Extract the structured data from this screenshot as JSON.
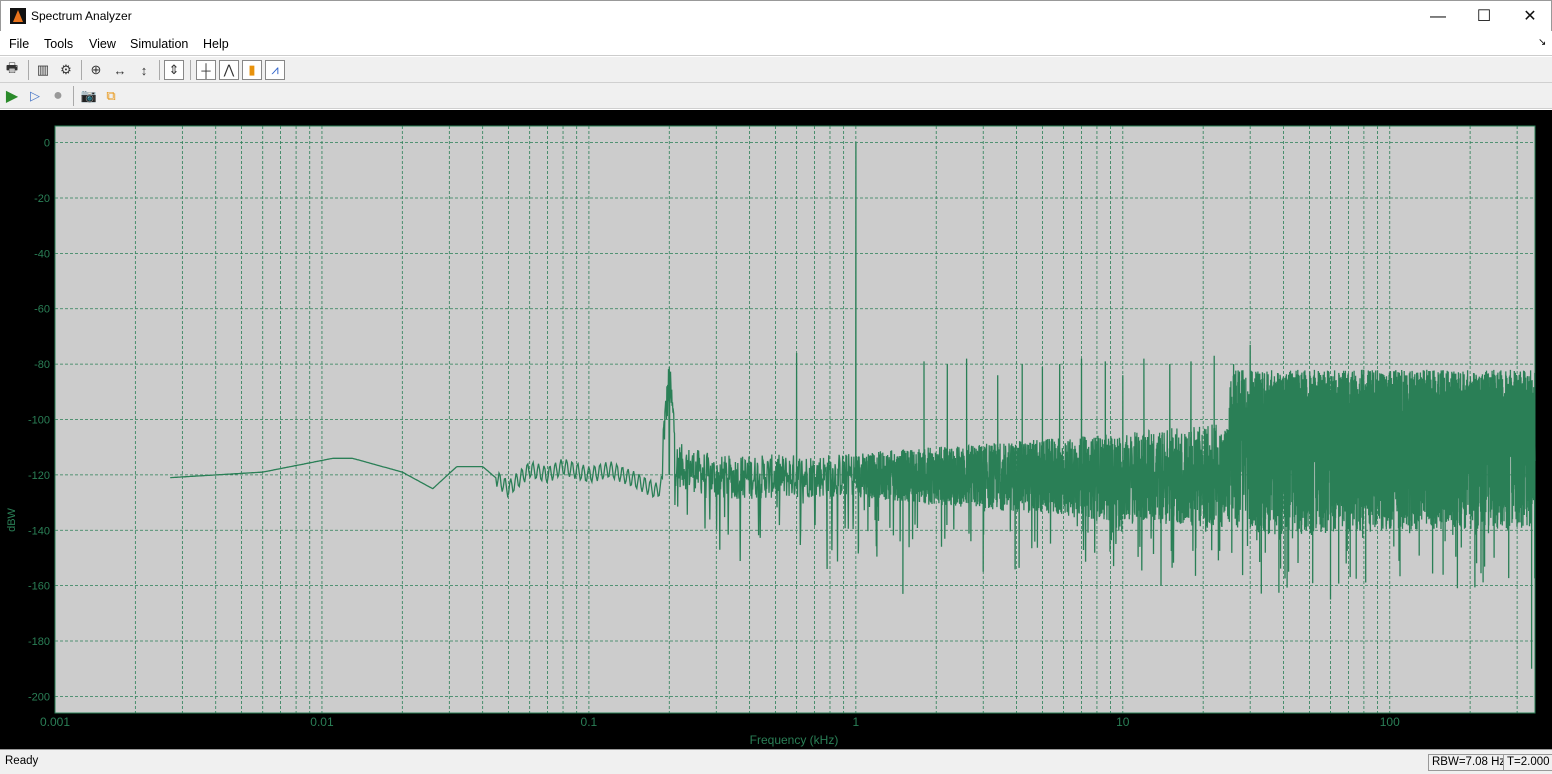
{
  "window": {
    "title": "Spectrum Analyzer",
    "minimize": "—",
    "maximize": "☐",
    "close": "✕"
  },
  "menu": [
    "File",
    "Tools",
    "View",
    "Simulation",
    "Help"
  ],
  "toolbar1": [
    "print-icon",
    "spectrum-settings-icon",
    "settings-gear-icon",
    "zoom-in-icon",
    "zoom-x-icon",
    "zoom-y-icon",
    "scale-axes-icon",
    "cursor-measurements-icon",
    "peak-finder-icon",
    "channel-measurements-icon",
    "distortion-measurements-icon"
  ],
  "toolbar2": [
    "run-icon",
    "step-forward-icon",
    "stop-icon",
    "snapshot-icon",
    "highlight-block-icon"
  ],
  "status": {
    "text": "Ready",
    "rbw": "RBW=7.08 Hz",
    "time": "T=2.000"
  },
  "colors": {
    "trace": "#2a7f56",
    "grid": "#2a7f56",
    "axes_bg": "#cccccc",
    "label": "#2a7f56"
  },
  "chart_data": {
    "type": "line",
    "xscale": "log",
    "xlabel": "Frequency (kHz)",
    "ylabel": "dBW",
    "xlim": [
      0.001,
      350
    ],
    "ylim": [
      -206,
      6
    ],
    "xticks": [
      0.001,
      0.01,
      0.1,
      1,
      10,
      100
    ],
    "xtick_labels": [
      "0.001",
      "0.01",
      "0.1",
      "1",
      "10",
      "100"
    ],
    "yticks": [
      0,
      -20,
      -40,
      -60,
      -80,
      -100,
      -120,
      -140,
      -160,
      -180,
      -200
    ],
    "grid": true,
    "baseline": [
      [
        0.0027,
        -121
      ],
      [
        0.006,
        -119
      ],
      [
        0.011,
        -114
      ],
      [
        0.013,
        -114
      ],
      [
        0.02,
        -119
      ],
      [
        0.026,
        -125
      ],
      [
        0.032,
        -117
      ],
      [
        0.04,
        -117
      ],
      [
        0.05,
        -125
      ],
      [
        0.06,
        -118
      ],
      [
        0.07,
        -120
      ],
      [
        0.08,
        -117
      ],
      [
        0.1,
        -120
      ],
      [
        0.12,
        -118
      ],
      [
        0.15,
        -122
      ],
      [
        0.18,
        -126
      ],
      [
        0.21,
        -116
      ],
      [
        0.3,
        -121
      ],
      [
        1,
        -120
      ],
      [
        10,
        -121
      ],
      [
        350,
        -117
      ]
    ],
    "peaks": [
      [
        0.2,
        -86
      ],
      [
        0.6,
        -76
      ],
      [
        1.0,
        0
      ],
      [
        1.8,
        -79
      ],
      [
        2.2,
        -80
      ],
      [
        2.6,
        -78
      ],
      [
        3.4,
        -84
      ],
      [
        4.2,
        -80
      ],
      [
        5.0,
        -81
      ],
      [
        5.8,
        -80
      ],
      [
        7,
        -78
      ],
      [
        8.6,
        -79
      ],
      [
        10,
        -84
      ],
      [
        12,
        -78
      ],
      [
        15,
        -80
      ],
      [
        18,
        -79
      ],
      [
        22,
        -77
      ],
      [
        26,
        -80
      ],
      [
        30,
        -73
      ]
    ],
    "dips": [
      [
        0.78,
        -154
      ],
      [
        1.5,
        -163
      ],
      [
        3.0,
        -155
      ],
      [
        60,
        -165
      ],
      [
        340,
        -190
      ]
    ]
  }
}
